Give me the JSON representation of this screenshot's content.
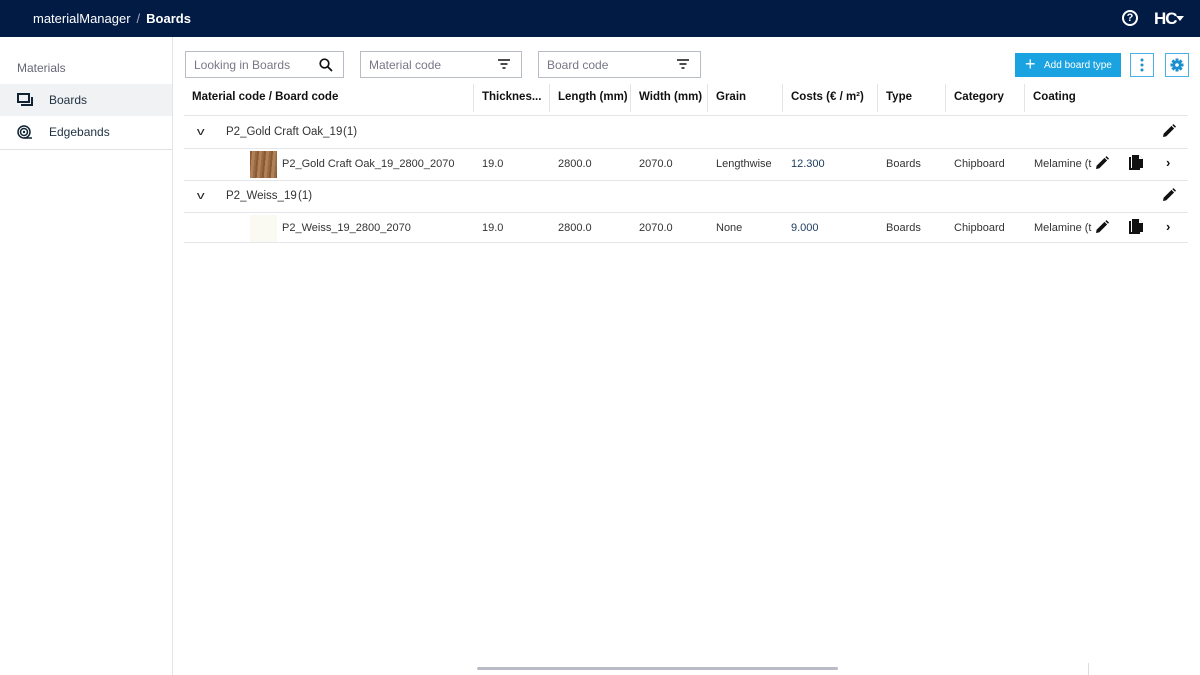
{
  "header": {
    "app": "materialManager",
    "separator": "/",
    "page": "Boards",
    "help_icon": "help-circle-icon",
    "logo": "HC"
  },
  "sidebar": {
    "title": "Materials",
    "items": [
      {
        "label": "Boards",
        "icon": "boards-icon",
        "active": true
      },
      {
        "label": "Edgebands",
        "icon": "edgeband-roll-icon",
        "active": false
      }
    ]
  },
  "filters": {
    "search_placeholder": "Looking in Boards",
    "material_code_placeholder": "Material code",
    "board_code_placeholder": "Board code"
  },
  "toolbar": {
    "add_label": "Add board type",
    "accent": "#1aa3e0"
  },
  "table": {
    "columns": [
      "Material code / Board code",
      "Thicknes...",
      "Length (mm)",
      "Width (mm)",
      "Grain",
      "Costs (€ / m²)",
      "Type",
      "Category",
      "Coating"
    ],
    "groups": [
      {
        "name": "P2_Gold Craft Oak_19",
        "count": "(1)",
        "rows": [
          {
            "code": "P2_Gold Craft Oak_19_2800_2070",
            "thickness": "19.0",
            "length": "2800.0",
            "width": "2070.0",
            "grain": "Lengthwise",
            "costs": "12.300",
            "type": "Boards",
            "category": "Chipboard",
            "coating": "Melamine (t",
            "swatch": "#a0734a"
          }
        ]
      },
      {
        "name": "P2_Weiss_19",
        "count": "(1)",
        "rows": [
          {
            "code": "P2_Weiss_19_2800_2070",
            "thickness": "19.0",
            "length": "2800.0",
            "width": "2070.0",
            "grain": "None",
            "costs": "9.000",
            "type": "Boards",
            "category": "Chipboard",
            "coating": "Melamine (t",
            "swatch": "#fafaf2"
          }
        ]
      }
    ]
  }
}
